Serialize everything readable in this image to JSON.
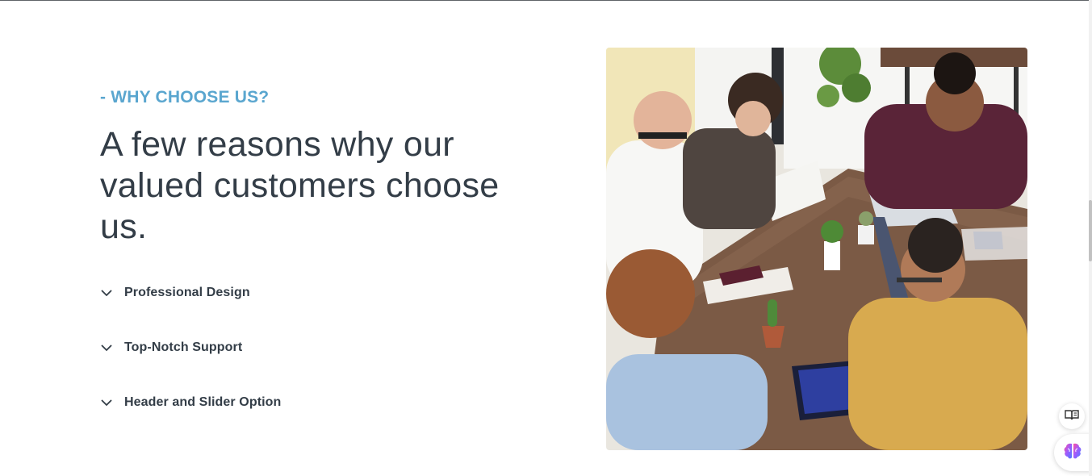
{
  "section": {
    "eyebrow": "- WHY CHOOSE US?",
    "headline": "A few reasons why our valued customers choose us."
  },
  "accordion": {
    "items": [
      {
        "label": "Professional Design",
        "icon": "chevron-down-icon"
      },
      {
        "label": "Top-Notch Support",
        "icon": "chevron-down-icon"
      },
      {
        "label": "Header and Slider Option",
        "icon": "chevron-down-icon"
      }
    ]
  },
  "image": {
    "subject": "team-meeting-photo"
  },
  "floating_buttons": {
    "reader_icon": "book-open-icon",
    "assistant_icon": "brain-icon"
  },
  "colors": {
    "accent": "#5aa6cf",
    "heading": "#333d47",
    "background": "#ffffff"
  }
}
